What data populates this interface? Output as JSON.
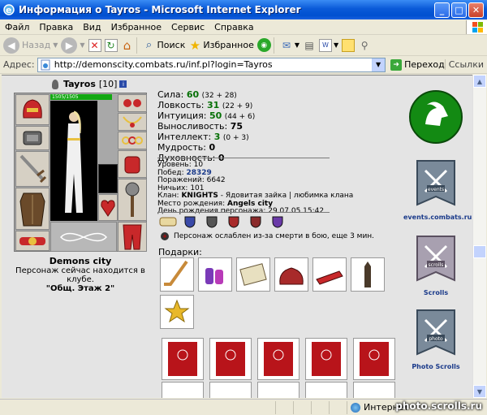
{
  "window": {
    "title": "Информация о Tayros - Microsoft Internet Explorer"
  },
  "menu": [
    "Файл",
    "Правка",
    "Вид",
    "Избранное",
    "Сервис",
    "Справка"
  ],
  "toolbar": {
    "back": "Назад",
    "search": "Поиск",
    "favorites": "Избранное"
  },
  "address": {
    "label": "Адрес:",
    "url": "http://demonscity.combats.ru/inf.pl?login=Tayros",
    "go": "Переход",
    "links": "Ссылки"
  },
  "status": {
    "zone": "Интернет"
  },
  "watermark": "photo.scrolls.ru",
  "character": {
    "name": "Tayros",
    "level": "[10]",
    "hp": "1505/1505",
    "city_name": "Demons city",
    "club_text": "Персонаж сейчас находится в клубе.",
    "club_place": "\"Общ. Этаж 2\""
  },
  "stats": [
    {
      "label": "Сила:",
      "value": "60",
      "extra": "(32 + 28)"
    },
    {
      "label": "Ловкость:",
      "value": "31",
      "extra": "(22 + 9)"
    },
    {
      "label": "Интуиция:",
      "value": "50",
      "extra": "(44 + 6)"
    },
    {
      "label": "Выносливость:",
      "value": "75",
      "extra": ""
    },
    {
      "label": "Интеллект:",
      "value": "3",
      "extra": "(0 + 3)"
    },
    {
      "label": "Мудрость:",
      "value": "0",
      "extra": ""
    },
    {
      "label": "Духовность:",
      "value": "0",
      "extra": ""
    }
  ],
  "info": {
    "level_label": "Уровень:",
    "level": "10",
    "wins_label": "Побед:",
    "wins": "28329",
    "losses_label": "Поражений:",
    "losses": "6642",
    "draws_label": "Ничьих:",
    "draws": "101",
    "clan_label": "Клан:",
    "clan": "KNIGHTS",
    "clan_rest": " - Ядовитая зайка | любимка клана",
    "birthplace_label": "Место рождения:",
    "birthplace": "Angels city",
    "birthday_label": "День рождения персонажа:",
    "birthday": "29.07.05 15:42"
  },
  "weakened": "Персонаж ослаблен из-за смерти в бою, еще 3 мин.",
  "gifts_label": "Подарки:",
  "right_banners": {
    "events": "events.combats.ru",
    "events_badge": "events",
    "scrolls": "Scrolls",
    "scrolls_badge": "scrolls",
    "photo": "Photo Scrolls",
    "photo_badge": "photo"
  },
  "colors": {
    "hp_bar": "#12a812",
    "stat_value": "#067006",
    "link_blue": "#1a3a8a",
    "xp_title": "#0a5ad8"
  }
}
